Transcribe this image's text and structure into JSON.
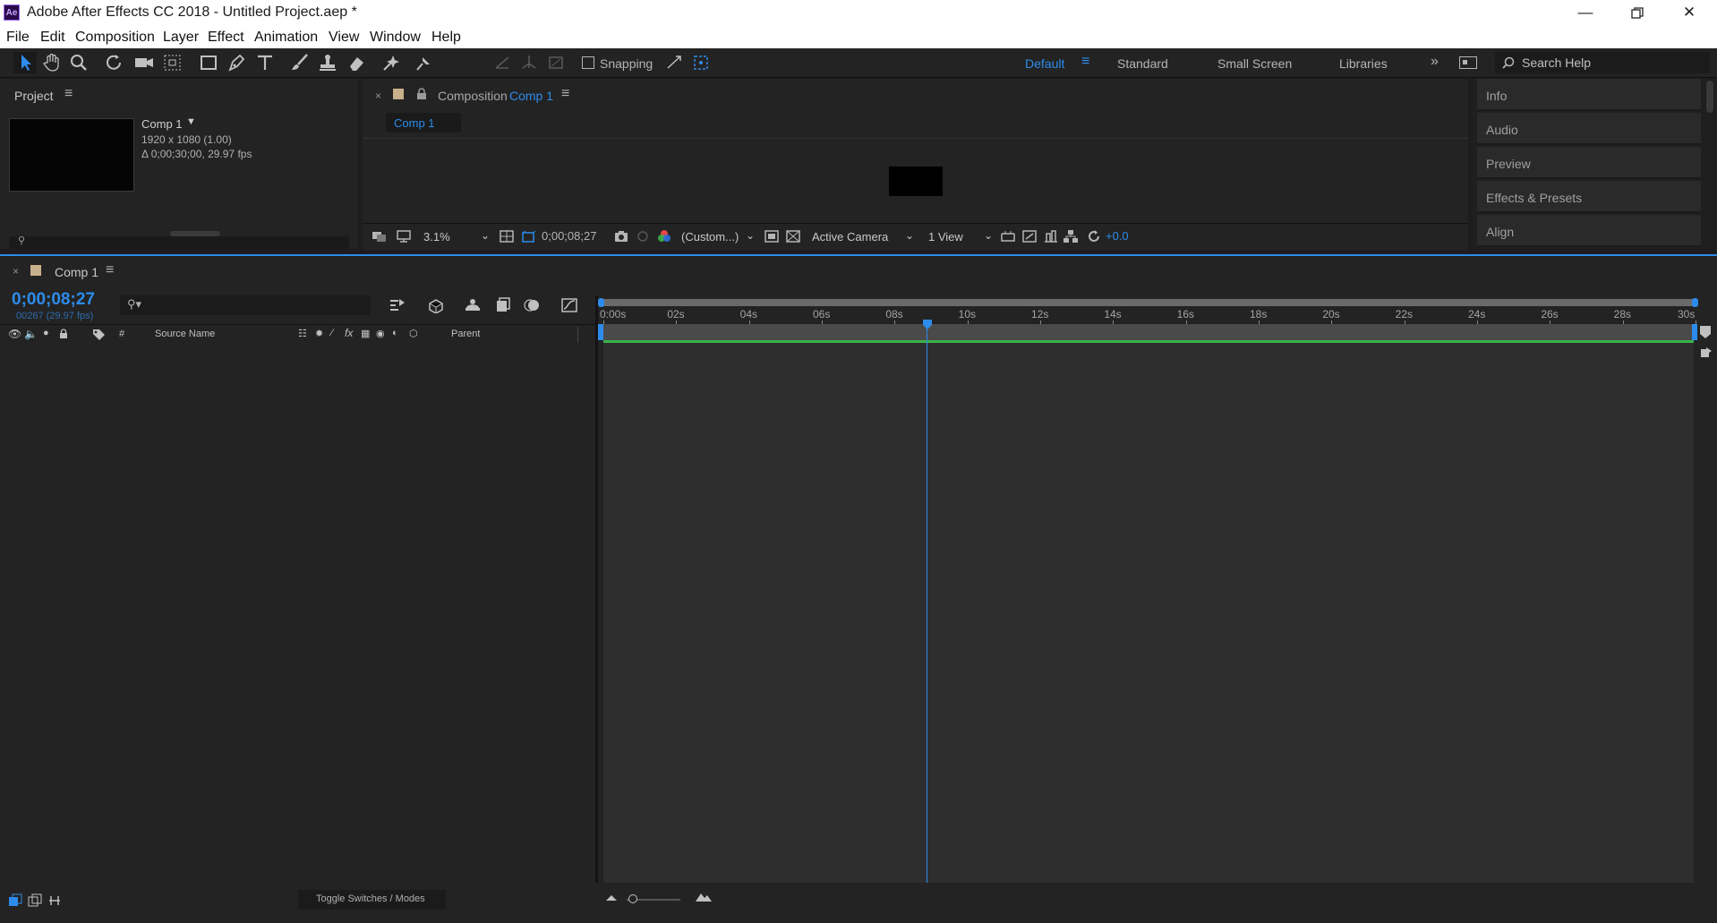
{
  "window": {
    "app_icon": "Ae",
    "title": "Adobe After Effects CC 2018 - Untitled Project.aep *",
    "controls": [
      "minimize-icon",
      "restore-icon",
      "close-icon"
    ]
  },
  "menu": [
    "File",
    "Edit",
    "Composition",
    "Layer",
    "Effect",
    "Animation",
    "View",
    "Window",
    "Help"
  ],
  "toolbar": {
    "snapping_label": "Snapping",
    "workspaces": [
      "Default",
      "Standard",
      "Small Screen",
      "Libraries"
    ],
    "active_workspace": "Default",
    "search_placeholder": "Search Help"
  },
  "project": {
    "tab": "Project",
    "item_name": "Comp 1",
    "item_res": "1920 x 1080 (1.00)",
    "item_duration": "Δ 0;00;30;00, 29.97 fps"
  },
  "composition": {
    "tab_prefix": "Composition",
    "tab_name": "Comp 1",
    "comp_button": "Comp 1",
    "zoom": "3.1%",
    "timecode": "0;00;08;27",
    "channel": "(Custom...)",
    "camera": "Active Camera",
    "views": "1 View",
    "exposure": "+0.0"
  },
  "right_panel": {
    "items": [
      "Info",
      "Audio",
      "Preview",
      "Effects & Presets",
      "Align"
    ]
  },
  "timeline": {
    "tab": "Comp 1",
    "timecode": "0;00;08;27",
    "frame_info": "00267 (29.97 fps)",
    "col_hash": "#",
    "col_source": "Source Name",
    "col_parent": "Parent",
    "toggle_label": "Toggle Switches / Modes",
    "ruler": [
      "0:00s",
      "02s",
      "04s",
      "06s",
      "08s",
      "10s",
      "12s",
      "14s",
      "16s",
      "18s",
      "20s",
      "22s",
      "24s",
      "26s",
      "28s",
      "30s"
    ],
    "playhead_seconds": 8.9,
    "duration_seconds": 30
  },
  "colors": {
    "accent": "#2d8ceb",
    "panel_bg": "#232323",
    "work_area": "#2e2e2e",
    "green_bar": "#3bb34a"
  }
}
